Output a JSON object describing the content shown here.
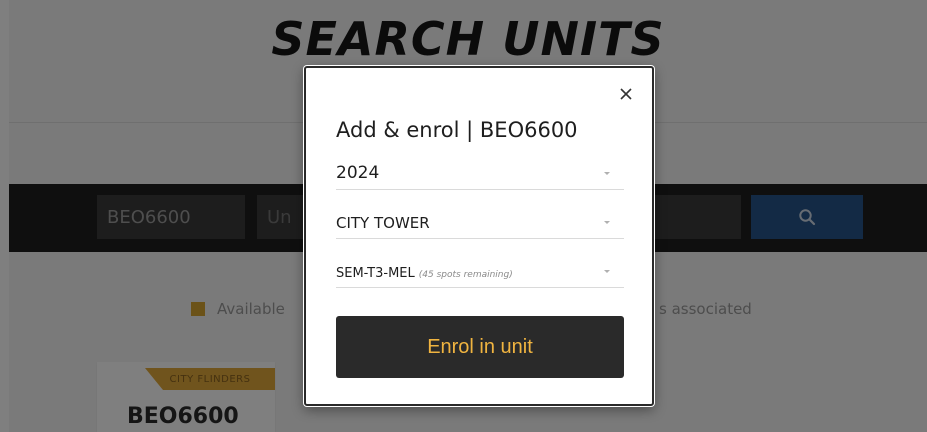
{
  "page": {
    "title": "SEARCH UNITS"
  },
  "search": {
    "unit_code_value": "BEO6600",
    "unit_name_value": "",
    "unit_name_placeholder": "Un"
  },
  "legend": {
    "available_label": "Available",
    "associated_label": "s associated"
  },
  "unit_card": {
    "campus": "CITY FLINDERS",
    "code": "BEO6600"
  },
  "modal": {
    "title": "Add & enrol | BEO6600",
    "year": "2024",
    "campus": "CITY TOWER",
    "class_code": "SEM-T3-MEL",
    "class_note": "(45 spots remaining)",
    "enrol_label": "Enrol in unit"
  },
  "icons": {
    "search": "search-icon",
    "close": "close-icon",
    "caret": "chevron-down-icon"
  },
  "colors": {
    "accent": "#f0b440",
    "dark": "#2a2a2a",
    "search_button": "#27558a",
    "available_swatch": "#d6a531"
  }
}
